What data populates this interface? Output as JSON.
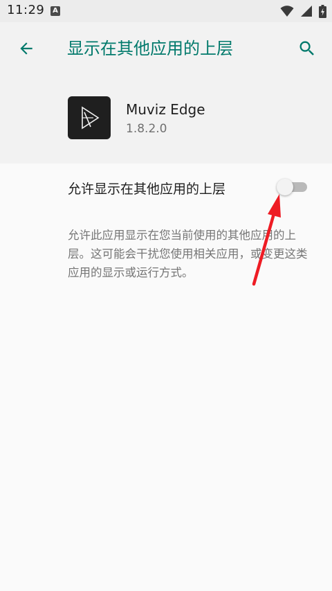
{
  "status_bar": {
    "time": "11:29",
    "notification_icon": "A",
    "icons": [
      "wifi-icon",
      "signal-icon",
      "battery-icon"
    ]
  },
  "app_bar": {
    "back_icon": "arrow-back-icon",
    "title": "显示在其他应用的上层",
    "search_icon": "search-icon",
    "accent_color": "#00796b"
  },
  "app_info": {
    "name": "Muviz Edge",
    "version": "1.8.2.0",
    "icon": "muviz-edge-logo"
  },
  "permission": {
    "label": "允许显示在其他应用的上层",
    "enabled": false
  },
  "description": "允许此应用显示在您当前使用的其他应用的上层。这可能会干扰您使用相关应用，或变更这类应用的显示或运行方式。",
  "annotation": {
    "type": "arrow",
    "color": "#ee1c24"
  }
}
